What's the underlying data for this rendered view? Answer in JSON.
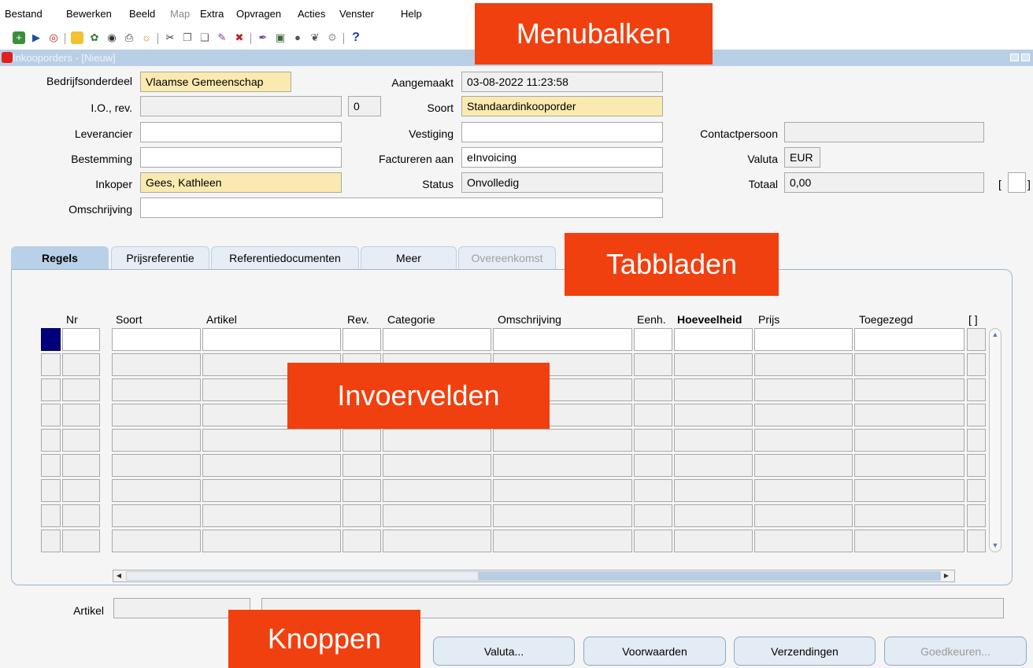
{
  "menu": {
    "items": [
      "Bestand",
      "Bewerken",
      "Beeld",
      "Map",
      "Extra",
      "Opvragen",
      "Acties",
      "Venster",
      "Help"
    ]
  },
  "toolbar": {
    "icons": [
      "new-record-icon",
      "tag-icon",
      "target-icon",
      "folder-open-icon",
      "tree-icon",
      "binoculars-icon",
      "print-icon",
      "globe-icon",
      "scissors-icon",
      "copy-icon",
      "paste-icon",
      "edit-icon",
      "delete-record-icon",
      "pen-icon",
      "translate-icon",
      "circle-icon",
      "attachment-icon",
      "tools-icon"
    ],
    "help_glyph": "?"
  },
  "window": {
    "title": "Inkooporders - [Nieuw]"
  },
  "header": {
    "bedrijfsonderdeel_label": "Bedrijfsonderdeel",
    "bedrijfsonderdeel_value": "Vlaamse Gemeenschap",
    "aangemaakt_label": "Aangemaakt",
    "aangemaakt_value": "03-08-2022 11:23:58",
    "io_label": "I.O., rev.",
    "io_value": "",
    "rev_value": "0",
    "soort_label": "Soort",
    "soort_value": "Standaardinkooporder",
    "leverancier_label": "Leverancier",
    "leverancier_value": "",
    "vestiging_label": "Vestiging",
    "vestiging_value": "",
    "contactpersoon_label": "Contactpersoon",
    "contactpersoon_value": "",
    "bestemming_label": "Bestemming",
    "bestemming_value": "",
    "factureren_label": "Factureren aan",
    "factureren_value": "eInvoicing",
    "valuta_label": "Valuta",
    "valuta_value": "EUR",
    "inkoper_label": "Inkoper",
    "inkoper_value": "Gees, Kathleen",
    "status_label": "Status",
    "status_value": "Onvolledig",
    "totaal_label": "Totaal",
    "totaal_value": "0,00",
    "bracket_open": "[",
    "bracket_close": "]",
    "omschrijving_label": "Omschrijving",
    "omschrijving_value": ""
  },
  "tabs": [
    "Regels",
    "Prijsreferentie",
    "Referentiedocumenten",
    "Meer",
    "Overeenkomst"
  ],
  "grid": {
    "columns": [
      "Nr",
      "Soort",
      "Artikel",
      "Rev.",
      "Categorie",
      "Omschrijving",
      "Eenh.",
      "Hoeveelheid",
      "Prijs",
      "Toegezegd",
      "[ ]"
    ],
    "row_count": 9
  },
  "footer": {
    "artikel_label": "Artikel",
    "artikel_value": "",
    "artikel_desc_value": ""
  },
  "buttons": {
    "valuta": "Valuta...",
    "voorwaarden": "Voorwaarden",
    "verzendingen": "Verzendingen",
    "goedkeuren": "Goedkeuren..."
  },
  "callouts": {
    "menubalken": "Menubalken",
    "tabbladen": "Tabbladen",
    "invoervelden": "Invoervelden",
    "knoppen": "Knoppen"
  },
  "colors": {
    "callout": "#f1400f",
    "required_field": "#fbeab0",
    "active_tab": "#b8d0e8",
    "row_indicator": "#00007a"
  }
}
